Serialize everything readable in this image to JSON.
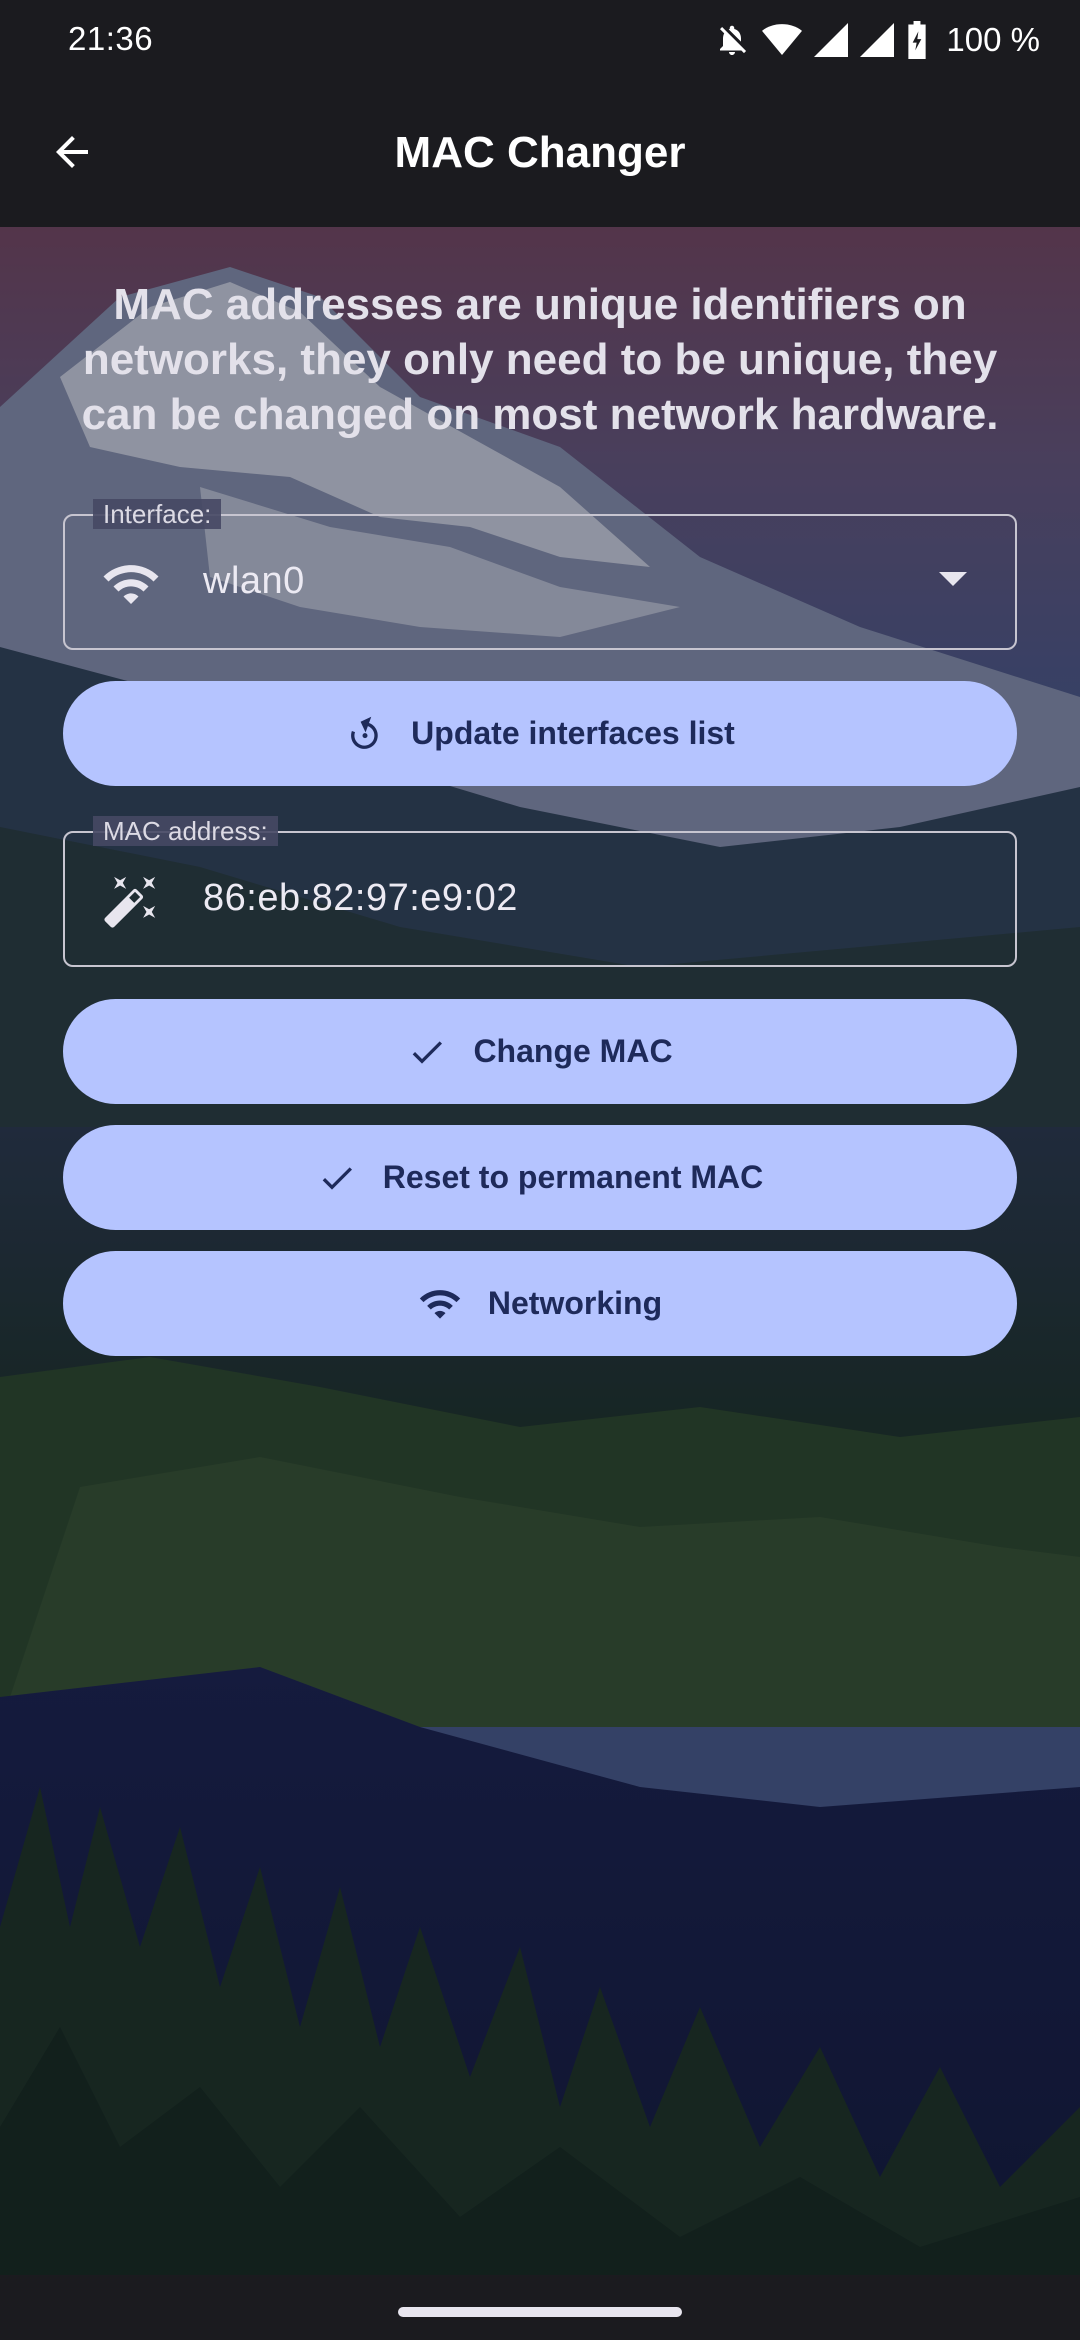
{
  "status_bar": {
    "time": "21:36",
    "battery": "100 %",
    "icons": [
      "notifications-off-icon",
      "wifi-icon",
      "cellular-signal-icon",
      "cellular-signal-icon",
      "battery-charging-icon"
    ]
  },
  "app_bar": {
    "title": "MAC Changer",
    "back_icon": "arrow-back-icon"
  },
  "intro": {
    "text": "MAC addresses are unique identifiers on networks, they only need to be unique, they can be changed on most network hardware."
  },
  "interface_field": {
    "label": "Interface:",
    "value": "wlan0",
    "icon": "wifi-icon"
  },
  "mac_field": {
    "label": "MAC address:",
    "value": "86:eb:82:97:e9:02",
    "icon": "magic-wand-icon"
  },
  "buttons": {
    "update_interfaces": {
      "label": "Update interfaces list",
      "icon": "refresh-icon"
    },
    "change_mac": {
      "label": "Change MAC",
      "icon": "check-icon"
    },
    "reset_mac": {
      "label": "Reset to permanent MAC",
      "icon": "check-icon"
    },
    "networking": {
      "label": "Networking",
      "icon": "wifi-icon"
    }
  },
  "colors": {
    "button_bg": "#b5c4ff",
    "button_text": "#1e2a5a",
    "bar_bg": "#1b1b1f"
  }
}
